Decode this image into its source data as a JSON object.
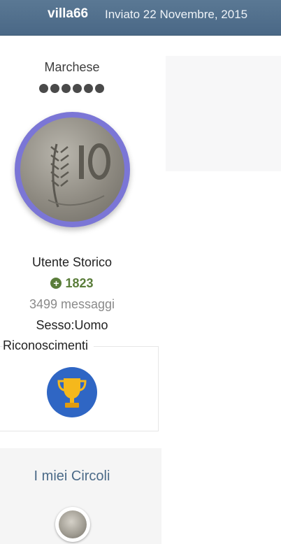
{
  "post_header": {
    "author": "villa66",
    "date": "Inviato 22 Novembre, 2015"
  },
  "author_panel": {
    "rank_title": "Marchese",
    "rank_pips": 6,
    "avatar_icon": "coin-avatar-icon",
    "group": "Utente Storico",
    "reputation": "1823",
    "reputation_icon": "plus-circle-icon",
    "posts_count": "3499 messaggi",
    "profile_field": "Sesso:Uomo",
    "awards": {
      "title": "Riconoscimenti",
      "badge_icon": "trophy-icon"
    },
    "circles": {
      "title": "I miei Circoli",
      "icon": "coin-circle-icon"
    }
  },
  "colors": {
    "header_bar": "#4f6d8b",
    "reputation_green": "#5a7d3a",
    "avatar_ring": "#7b76d6",
    "award_badge_blue": "#2f66c4",
    "circles_title": "#4b6a88"
  }
}
